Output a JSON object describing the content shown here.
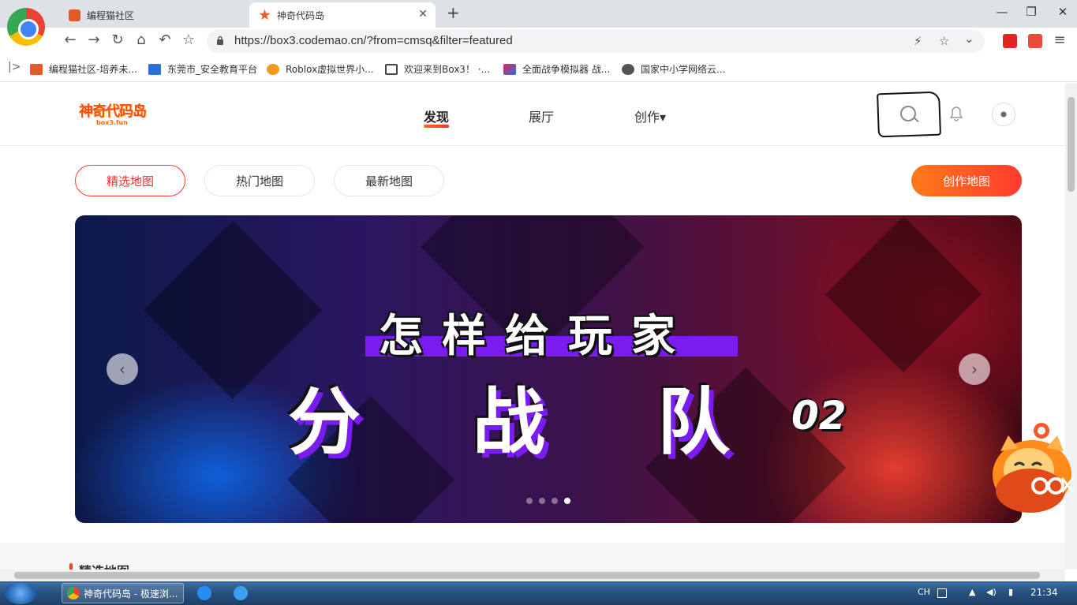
{
  "browser": {
    "tabs": [
      {
        "label": "编程猫社区"
      },
      {
        "label": "神奇代码岛"
      }
    ],
    "url": "https://box3.codemao.cn/?from=cmsq&filter=featured",
    "bookmarks": [
      {
        "label": "编程猫社区-培养未..."
      },
      {
        "label": "东莞市_安全教育平台"
      },
      {
        "label": "Roblox虚拟世界小..."
      },
      {
        "label": "欢迎来到Box3！ ·..."
      },
      {
        "label": "全面战争模拟器 战..."
      },
      {
        "label": "国家中小学网络云..."
      }
    ],
    "toolbar_glyphs": {
      "back": "←",
      "forward": "→",
      "reload": "↻",
      "home": "⌂",
      "undo": "↶",
      "star": "☆",
      "new_tab": "+",
      "close": "✕",
      "minimize": "—",
      "restore": "❐",
      "menu": "≡",
      "bolt": "⚡",
      "chevron": "⌄",
      "lock": "🔒"
    }
  },
  "site": {
    "logo_text": "神奇代码岛",
    "logo_sub": "box3.fun",
    "nav": {
      "discover": "发现",
      "hall": "展厅",
      "create": "创作▾"
    },
    "filters": {
      "featured": "精选地图",
      "hot": "热门地图",
      "new": "最新地图"
    },
    "create_map": "创作地图"
  },
  "banner": {
    "line1": "怎样给玩家",
    "line2": "分 战 队",
    "number": "02",
    "prev": "‹",
    "next": "›",
    "dots": 4,
    "active_dot": 3
  },
  "section": {
    "title": "精选地图"
  },
  "taskbar": {
    "active_task": "神奇代码岛 - 极速浏...",
    "ime": "CH",
    "clock": "21:34"
  },
  "colors": {
    "accent": "#ff3b2f",
    "accent_orange": "#ff7a1a",
    "banner_purple": "#7a1cf0"
  }
}
